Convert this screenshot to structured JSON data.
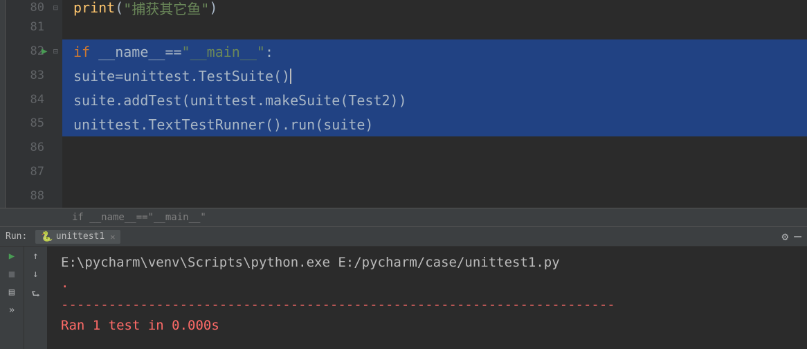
{
  "editor": {
    "lines": [
      {
        "num": "80",
        "indent": "            ",
        "tokens": [
          {
            "t": "func",
            "v": "print"
          },
          {
            "t": "txt",
            "v": "("
          },
          {
            "t": "str",
            "v": "\"捕获其它鱼\""
          },
          {
            "t": "txt",
            "v": ")"
          }
        ],
        "selected": false,
        "hasRun": false,
        "hasFold": true
      },
      {
        "num": "81",
        "indent": "",
        "tokens": [],
        "selected": false,
        "hasRun": false,
        "hasFold": false
      },
      {
        "num": "82",
        "indent": "",
        "tokens": [
          {
            "t": "kw",
            "v": "if"
          },
          {
            "t": "txt",
            "v": " __name__=="
          },
          {
            "t": "str",
            "v": "\"__main__\""
          },
          {
            "t": "txt",
            "v": ":"
          }
        ],
        "selected": true,
        "hasRun": true,
        "hasFold": true
      },
      {
        "num": "83",
        "indent": "    ",
        "tokens": [
          {
            "t": "txt",
            "v": "suite=unittest.TestSuite()"
          }
        ],
        "selected": true,
        "hasRun": false,
        "hasFold": false,
        "hasCursor": true
      },
      {
        "num": "84",
        "indent": "    ",
        "tokens": [
          {
            "t": "txt",
            "v": "suite.addTest(unittest.makeSuite(Test2))"
          }
        ],
        "selected": true,
        "hasRun": false,
        "hasFold": false
      },
      {
        "num": "85",
        "indent": "    ",
        "tokens": [
          {
            "t": "txt",
            "v": "unittest.TextTestRunner().run(suite)"
          }
        ],
        "selected": true,
        "hasRun": false,
        "hasFold": false
      },
      {
        "num": "86",
        "indent": "",
        "tokens": [],
        "selected": false,
        "hasRun": false,
        "hasFold": false
      },
      {
        "num": "87",
        "indent": "",
        "tokens": [],
        "selected": false,
        "hasRun": false,
        "hasFold": false
      },
      {
        "num": "88",
        "indent": "",
        "tokens": [],
        "selected": false,
        "hasRun": false,
        "hasFold": false
      }
    ]
  },
  "breadcrumb": "if __name__==\"__main__\"",
  "runPanel": {
    "label": "Run:",
    "tabName": "unittest1",
    "console": {
      "line1": "E:\\pycharm\\venv\\Scripts\\python.exe E:/pycharm/case/unittest1.py",
      "line2": ".",
      "line3": "----------------------------------------------------------------------",
      "line4": "Ran 1 test in 0.000s"
    }
  },
  "icons": {
    "play": "▶",
    "foldMinus": "⊟",
    "foldPlus": "⊟",
    "close": "✕",
    "gear": "⚙",
    "minus": "—",
    "stop": "■",
    "arrowUp": "↑",
    "arrowDown": "↓",
    "wrap": "⮑",
    "doubleRight": "»"
  }
}
